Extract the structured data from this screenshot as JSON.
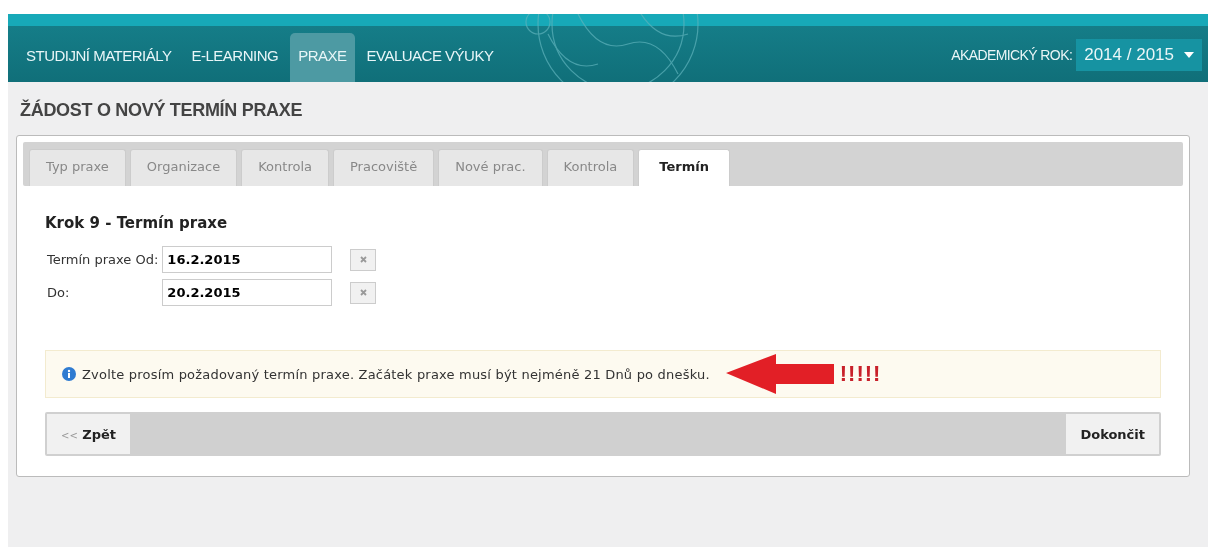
{
  "nav": {
    "items": [
      {
        "label": "STUDIJNÍ MATERIÁLY",
        "selected": false
      },
      {
        "label": "E-LEARNING",
        "selected": false
      },
      {
        "label": "PRAXE",
        "selected": true
      },
      {
        "label": "EVALUACE VÝUKY",
        "selected": false
      }
    ],
    "year_label": "AKADEMICKÝ ROK:",
    "year_value": "2014 / 2015"
  },
  "page_title": "ŽÁDOST O NOVÝ TERMÍN PRAXE",
  "tabs": [
    {
      "label": "Typ praxe",
      "selected": false
    },
    {
      "label": "Organizace",
      "selected": false
    },
    {
      "label": "Kontrola",
      "selected": false
    },
    {
      "label": "Pracoviště",
      "selected": false
    },
    {
      "label": "Nové prac.",
      "selected": false
    },
    {
      "label": "Kontrola",
      "selected": false
    },
    {
      "label": "Termín",
      "selected": true
    }
  ],
  "step_title": "Krok 9 - Termín praxe",
  "fields": [
    {
      "label": "Termín praxe Od:",
      "value": "16.2.2015"
    },
    {
      "label": "Do:",
      "value": "20.2.2015"
    }
  ],
  "notice": {
    "text": "Zvolte prosím požadovaný termín praxe. Začátek praxe musí být nejméně 21 Dnů po dnešku.",
    "annotation": "!!!!!"
  },
  "buttons": {
    "back": {
      "icon": "<<",
      "label": "Zpět"
    },
    "finish": "Dokončit"
  }
}
